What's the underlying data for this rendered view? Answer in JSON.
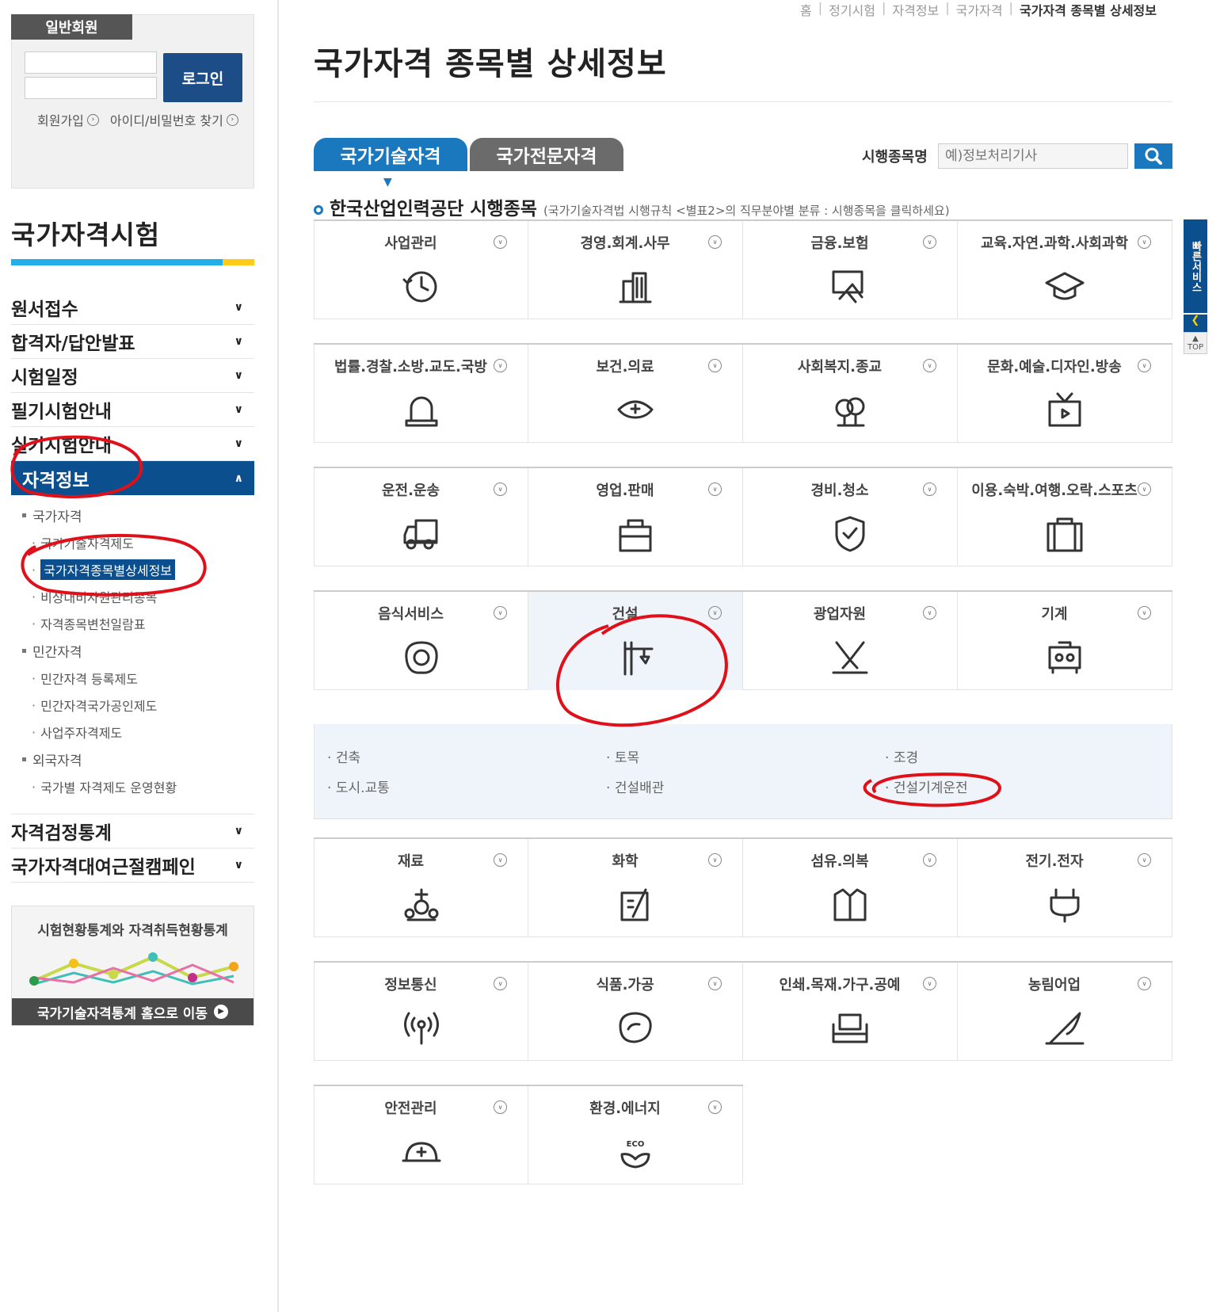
{
  "login": {
    "tab": "일반회원",
    "button": "로그인",
    "links": [
      "회원가입",
      "아이디/비밀번호 찾기"
    ]
  },
  "sidebar": {
    "title": "국가자격시험",
    "menu": [
      "원서접수",
      "합격자/답안발표",
      "시험일정",
      "필기시험안내",
      "실기시험안내"
    ],
    "active": "자격정보",
    "sub": {
      "g1": "국가자격",
      "g1_items": [
        "국가기술자격제도",
        "국가자격종목별상세정보",
        "비상대비자원관리종목",
        "자격종목변천일람표"
      ],
      "g2": "민간자격",
      "g2_items": [
        "민간자격 등록제도",
        "민간자격국가공인제도",
        "사업주자격제도"
      ],
      "g3": "외국자격",
      "g3_items": [
        "국가별 자격제도 운영현황"
      ]
    },
    "menu2": [
      "자격검정통계",
      "국가자격대여근절캠페인"
    ],
    "banner": {
      "title": "시험현황통계와 자격취득현황통계",
      "link": "국가기술자격통계 홈으로 이동"
    }
  },
  "breadcrumb": [
    "홈",
    "정기시험",
    "자격정보",
    "국가자격",
    "국가자격 종목별 상세정보"
  ],
  "page": {
    "title": "국가자격 종목별 상세정보",
    "tabs": [
      "국가기술자격",
      "국가전문자격"
    ],
    "search_label": "시행종목명",
    "search_placeholder": "예)정보처리기사",
    "section_title": "한국산업인력공단 시행종목",
    "section_note": "(국가기술자격법 시행규칙 <별표2>의 직무분야별 분류 : 시행종목을 클릭하세요)"
  },
  "categories": [
    [
      {
        "name": "사업관리",
        "icon": "clock-icon"
      },
      {
        "name": "경영.회계.사무",
        "icon": "building-icon"
      },
      {
        "name": "금융.보험",
        "icon": "finance-screen-icon"
      },
      {
        "name": "교육.자연.과학.사회과학",
        "icon": "graduation-cap-icon"
      }
    ],
    [
      {
        "name": "법률.경찰.소방.교도.국방",
        "icon": "siren-icon"
      },
      {
        "name": "보건.의료",
        "icon": "nurse-cap-icon"
      },
      {
        "name": "사회복지.종교",
        "icon": "tree-icon"
      },
      {
        "name": "문화.예술.디자인.방송",
        "icon": "tv-icon"
      }
    ],
    [
      {
        "name": "운전.운송",
        "icon": "truck-icon"
      },
      {
        "name": "영업.판매",
        "icon": "shopping-bag-icon"
      },
      {
        "name": "경비.청소",
        "icon": "shield-icon"
      },
      {
        "name": "이용.숙박.여행.오락.스포츠",
        "icon": "suitcase-icon"
      }
    ],
    [
      {
        "name": "음식서비스",
        "icon": "egg-icon"
      },
      {
        "name": "건설",
        "icon": "crane-icon"
      },
      {
        "name": "광업자원",
        "icon": "mining-icon"
      },
      {
        "name": "기계",
        "icon": "machine-icon"
      }
    ],
    [
      {
        "name": "재료",
        "icon": "material-icon"
      },
      {
        "name": "화학",
        "icon": "chemistry-icon"
      },
      {
        "name": "섬유.의복",
        "icon": "jacket-icon"
      },
      {
        "name": "전기.전자",
        "icon": "plug-icon"
      }
    ],
    [
      {
        "name": "정보통신",
        "icon": "antenna-icon"
      },
      {
        "name": "식품.가공",
        "icon": "meat-icon"
      },
      {
        "name": "인쇄.목재.가구.공예",
        "icon": "sofa-icon"
      },
      {
        "name": "농림어업",
        "icon": "plant-icon"
      }
    ],
    [
      {
        "name": "안전관리",
        "icon": "hardhat-icon"
      },
      {
        "name": "환경.에너지",
        "icon": "eco-icon"
      }
    ]
  ],
  "construction_sub": [
    "건축",
    "토목",
    "조경",
    "도시.교통",
    "건설배관",
    "건설기계운전"
  ],
  "eco_text": "ECO",
  "quick": {
    "label": "빠른서비스",
    "top": "TOP"
  },
  "colors": {
    "primary": "#0c4f8e",
    "tab_active": "#1a78bf",
    "tab_inactive": "#6b6b6b",
    "annotation": "#e0101a"
  }
}
